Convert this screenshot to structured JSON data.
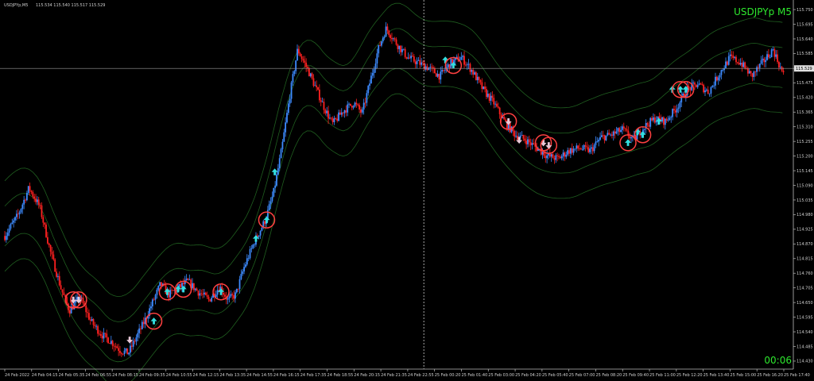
{
  "window": {
    "title": "USDJPYp,M5",
    "quote": "115.534 115.540 115.517 115.529",
    "symbol_label": "USDJPYp M5",
    "timer": "00:06"
  },
  "colors": {
    "background": "#000000",
    "bull": "#3d8bff",
    "bear": "#ff2020",
    "band": "#1f5e1f",
    "arrow_up": "#33e0e0",
    "arrow_down": "#e8c8d8",
    "circle": "#ff4040",
    "text": "#d0d0d0",
    "accent": "#2ee82e"
  },
  "chart_data": {
    "type": "candlestick",
    "symbol": "USDJPYp",
    "timeframe": "M5",
    "ylim": [
      114.4,
      115.78
    ],
    "current_price": 115.529,
    "y_ticks": [
      115.75,
      115.695,
      115.64,
      115.585,
      115.529,
      115.475,
      115.42,
      115.365,
      115.31,
      115.255,
      115.2,
      115.145,
      115.09,
      115.035,
      114.98,
      114.925,
      114.87,
      114.815,
      114.76,
      114.705,
      114.65,
      114.595,
      114.54,
      114.485,
      114.43
    ],
    "x_ticks": [
      "24 Feb 2022",
      "24 Feb 04:15",
      "24 Feb 05:35",
      "24 Feb 06:55",
      "24 Feb 08:15",
      "24 Feb 09:35",
      "24 Feb 10:55",
      "24 Feb 12:15",
      "24 Feb 13:35",
      "24 Feb 14:55",
      "24 Feb 16:15",
      "24 Feb 17:35",
      "24 Feb 18:55",
      "24 Feb 20:15",
      "24 Feb 21:35",
      "24 Feb 22:55",
      "25 Feb 00:20",
      "25 Feb 01:40",
      "25 Feb 03:00",
      "25 Feb 04:20",
      "25 Feb 05:40",
      "25 Feb 07:00",
      "25 Feb 08:20",
      "25 Feb 09:40",
      "25 Feb 11:00",
      "25 Feb 12:20",
      "25 Feb 13:40",
      "25 Feb 15:00",
      "25 Feb 16:20",
      "25 Feb 17:40"
    ],
    "grid": false,
    "day_separator_index": 15.6,
    "price_path": [
      [
        0,
        114.9
      ],
      [
        0.5,
        114.98
      ],
      [
        0.9,
        115.08
      ],
      [
        1.3,
        115.01
      ],
      [
        1.7,
        114.84
      ],
      [
        2.1,
        114.7
      ],
      [
        2.4,
        114.62
      ],
      [
        2.8,
        114.67
      ],
      [
        3.2,
        114.58
      ],
      [
        3.6,
        114.53
      ],
      [
        4.0,
        114.5
      ],
      [
        4.3,
        114.47
      ],
      [
        4.6,
        114.46
      ],
      [
        4.9,
        114.52
      ],
      [
        5.2,
        114.58
      ],
      [
        5.5,
        114.65
      ],
      [
        5.8,
        114.72
      ],
      [
        6.1,
        114.68
      ],
      [
        6.4,
        114.7
      ],
      [
        6.8,
        114.73
      ],
      [
        7.2,
        114.69
      ],
      [
        7.6,
        114.66
      ],
      [
        8.0,
        114.71
      ],
      [
        8.3,
        114.66
      ],
      [
        8.6,
        114.68
      ],
      [
        8.9,
        114.78
      ],
      [
        9.3,
        114.88
      ],
      [
        9.7,
        114.96
      ],
      [
        10.0,
        115.06
      ],
      [
        10.3,
        115.22
      ],
      [
        10.6,
        115.42
      ],
      [
        10.9,
        115.6
      ],
      [
        11.3,
        115.52
      ],
      [
        11.6,
        115.45
      ],
      [
        11.9,
        115.38
      ],
      [
        12.2,
        115.32
      ],
      [
        12.6,
        115.37
      ],
      [
        13.0,
        115.4
      ],
      [
        13.3,
        115.36
      ],
      [
        13.6,
        115.48
      ],
      [
        13.9,
        115.6
      ],
      [
        14.2,
        115.68
      ],
      [
        14.6,
        115.62
      ],
      [
        15.0,
        115.57
      ],
      [
        15.4,
        115.55
      ],
      [
        15.8,
        115.53
      ],
      [
        16.2,
        115.5
      ],
      [
        16.6,
        115.55
      ],
      [
        17.0,
        115.57
      ],
      [
        17.4,
        115.52
      ],
      [
        17.8,
        115.45
      ],
      [
        18.2,
        115.4
      ],
      [
        18.6,
        115.33
      ],
      [
        19.0,
        115.28
      ],
      [
        19.4,
        115.26
      ],
      [
        19.8,
        115.23
      ],
      [
        20.2,
        115.2
      ],
      [
        20.6,
        115.19
      ],
      [
        21.0,
        115.22
      ],
      [
        21.4,
        115.23
      ],
      [
        21.8,
        115.22
      ],
      [
        22.2,
        115.27
      ],
      [
        22.6,
        115.28
      ],
      [
        23.0,
        115.3
      ],
      [
        23.4,
        115.26
      ],
      [
        23.8,
        115.31
      ],
      [
        24.2,
        115.34
      ],
      [
        24.6,
        115.33
      ],
      [
        25.0,
        115.38
      ],
      [
        25.4,
        115.45
      ],
      [
        25.8,
        115.47
      ],
      [
        26.2,
        115.44
      ],
      [
        26.6,
        115.51
      ],
      [
        27.0,
        115.57
      ],
      [
        27.4,
        115.55
      ],
      [
        27.8,
        115.5
      ],
      [
        28.2,
        115.55
      ],
      [
        28.6,
        115.6
      ],
      [
        29.0,
        115.5
      ]
    ],
    "signals": [
      {
        "i": 2.55,
        "p": 114.66,
        "dir": "down",
        "circle": true
      },
      {
        "i": 2.75,
        "p": 114.66,
        "dir": "down",
        "circle": true
      },
      {
        "i": 4.65,
        "p": 114.51,
        "dir": "down",
        "circle": false
      },
      {
        "i": 5.55,
        "p": 114.58,
        "dir": "up",
        "circle": true
      },
      {
        "i": 6.05,
        "p": 114.69,
        "dir": "up",
        "circle": true
      },
      {
        "i": 6.45,
        "p": 114.7,
        "dir": "up",
        "circle": false
      },
      {
        "i": 6.65,
        "p": 114.7,
        "dir": "up",
        "circle": true
      },
      {
        "i": 8.05,
        "p": 114.69,
        "dir": "up",
        "circle": true
      },
      {
        "i": 9.35,
        "p": 114.89,
        "dir": "up",
        "circle": false
      },
      {
        "i": 9.75,
        "p": 114.96,
        "dir": "up",
        "circle": true
      },
      {
        "i": 10.05,
        "p": 115.14,
        "dir": "up",
        "circle": false
      },
      {
        "i": 16.4,
        "p": 115.56,
        "dir": "up",
        "circle": false
      },
      {
        "i": 16.7,
        "p": 115.54,
        "dir": "up",
        "circle": true
      },
      {
        "i": 18.75,
        "p": 115.33,
        "dir": "down",
        "circle": true
      },
      {
        "i": 19.15,
        "p": 115.26,
        "dir": "down",
        "circle": false
      },
      {
        "i": 20.05,
        "p": 115.25,
        "dir": "down",
        "circle": true
      },
      {
        "i": 20.25,
        "p": 115.24,
        "dir": "down",
        "circle": true
      },
      {
        "i": 23.2,
        "p": 115.25,
        "dir": "up",
        "circle": true
      },
      {
        "i": 23.55,
        "p": 115.29,
        "dir": "up",
        "circle": false
      },
      {
        "i": 23.75,
        "p": 115.28,
        "dir": "up",
        "circle": true
      },
      {
        "i": 24.35,
        "p": 115.33,
        "dir": "up",
        "circle": false
      },
      {
        "i": 24.85,
        "p": 115.45,
        "dir": "up",
        "circle": false
      },
      {
        "i": 25.15,
        "p": 115.45,
        "dir": "up",
        "circle": true
      },
      {
        "i": 25.35,
        "p": 115.45,
        "dir": "up",
        "circle": true
      }
    ]
  }
}
